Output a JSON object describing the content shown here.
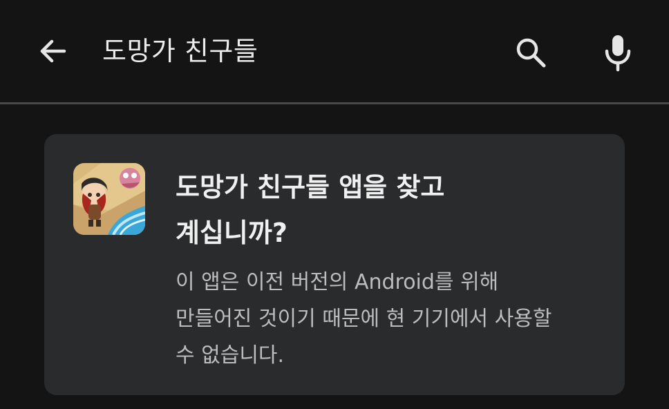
{
  "search": {
    "query": "도망가 친구들",
    "back_icon": "arrow-back-icon",
    "search_icon": "search-icon",
    "mic_icon": "mic-icon"
  },
  "card": {
    "title": "도망가 친구들 앱을 찾고\n계십니까?",
    "description": "이 앱은 이전 버전의 Android를 위해\n만들어진 것이기 때문에 현 기기에서 사용할\n수 없습니다.",
    "app_icon": "game-app-icon"
  },
  "colors": {
    "background": "#141414",
    "card": "#2a2b2d",
    "divider": "#4a4a4a",
    "text_primary": "#f0f0f0",
    "text_secondary": "#bdbdbd"
  }
}
